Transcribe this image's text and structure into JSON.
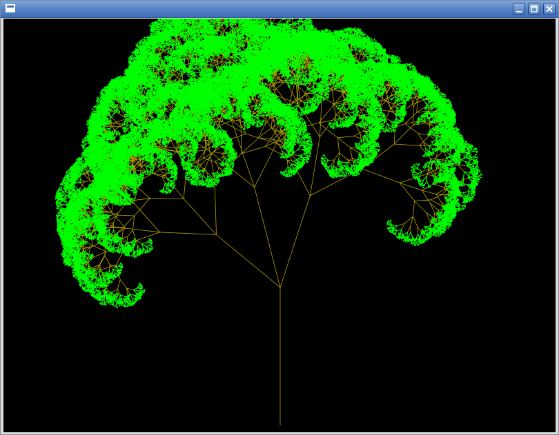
{
  "window": {
    "title": "",
    "icon": "window-icon",
    "controls": [
      {
        "name": "minimize-button",
        "icon": "minimize-icon"
      },
      {
        "name": "maximize-button",
        "icon": "maximize-icon"
      },
      {
        "name": "close-button",
        "icon": "close-icon"
      }
    ]
  },
  "canvas": {
    "background": "#000000",
    "branch_color": "#b3a600",
    "leaf_color": "#00ff00"
  }
}
